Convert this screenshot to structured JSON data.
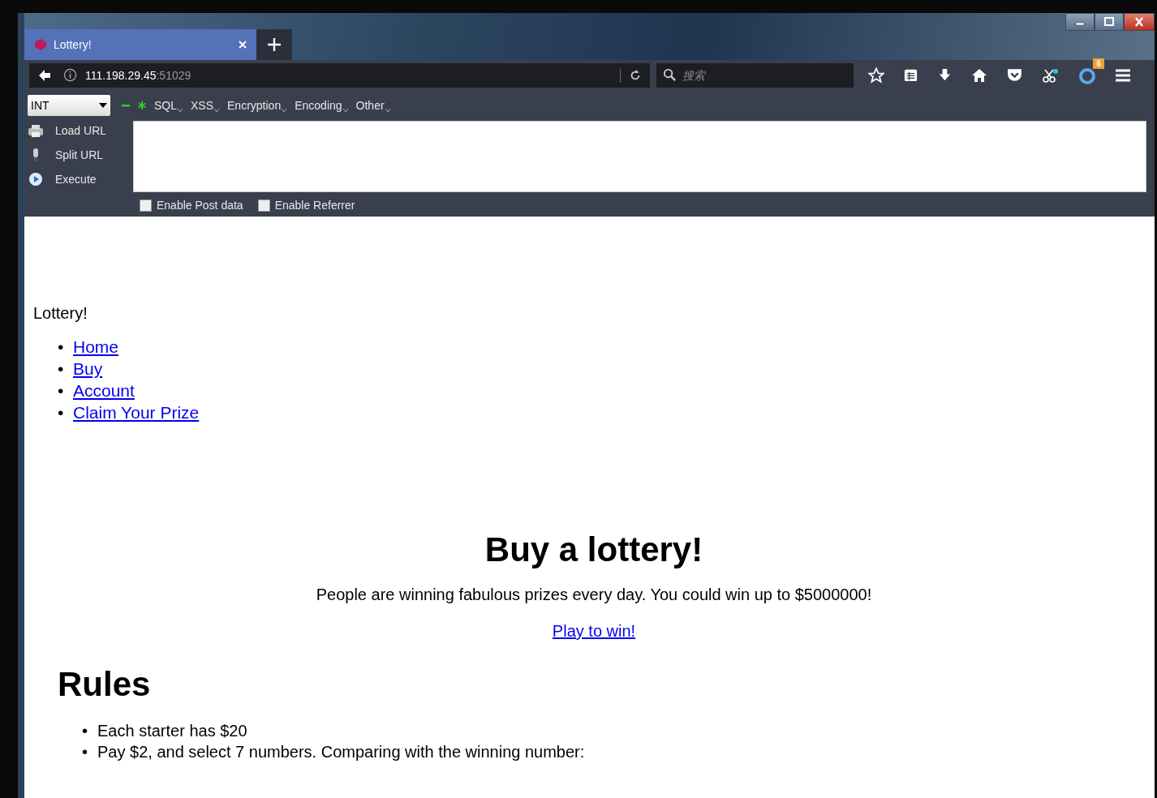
{
  "tabs": [
    {
      "title": "Lottery!",
      "selected": true
    }
  ],
  "address_bar": {
    "host": "111.198.29.45",
    "port": ":51029"
  },
  "search": {
    "placeholder": "搜索"
  },
  "toolbar": {
    "badge": "6"
  },
  "hackbar": {
    "select": "INT",
    "menus": [
      "SQL",
      "XSS",
      "Encryption",
      "Encoding",
      "Other"
    ],
    "actions": [
      {
        "label": "Load URL",
        "kind": "load"
      },
      {
        "label": "Split URL",
        "kind": "split"
      },
      {
        "label": "Execute",
        "kind": "execute"
      }
    ],
    "options": [
      {
        "label": "Enable Post data",
        "checked": false
      },
      {
        "label": "Enable Referrer",
        "checked": false
      }
    ]
  },
  "page": {
    "site_title": "Lottery!",
    "nav": [
      {
        "marker": "•",
        "label": "Home"
      },
      {
        "marker": "•",
        "label": "Buy"
      },
      {
        "marker": "•",
        "label": "Account"
      },
      {
        "marker": "•",
        "label": "Claim Your Prize"
      }
    ],
    "heading": "Buy a lottery!",
    "intro": "People are winning fabulous prizes every day. You could win up to $5000000!",
    "cta": "Play to win!",
    "rules_title": "Rules",
    "rules": [
      {
        "marker": "•",
        "text": "Each starter has $20"
      },
      {
        "marker": "•",
        "text": "Pay $2, and select 7 numbers. Comparing with the winning number:"
      }
    ]
  }
}
